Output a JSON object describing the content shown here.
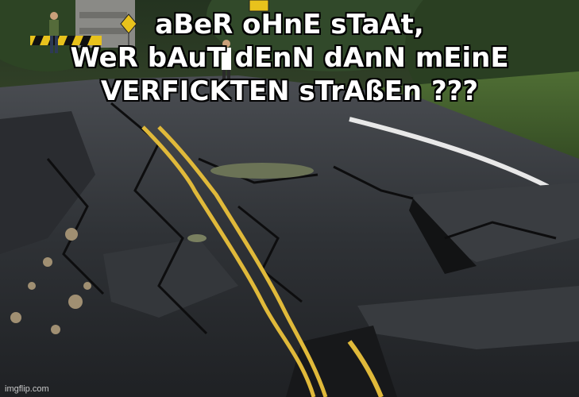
{
  "meme": {
    "caption_lines": [
      "aBeR oHnE sTaAt,",
      "WeR bAuT dEnN dAnN mEinE",
      "VERFICKTEN sTrAßEn ???"
    ],
    "watermark": "imgflip.com"
  },
  "colors": {
    "asphalt": "#2c2e31",
    "road_line_yellow": "#e0b93a",
    "edge_line_white": "#e8e8e8",
    "foliage": "#3d5a2a",
    "caption_text": "#ffffff",
    "caption_outline": "#000000"
  },
  "icons": [
    "warning-sign-icon",
    "speed-sign-icon"
  ]
}
